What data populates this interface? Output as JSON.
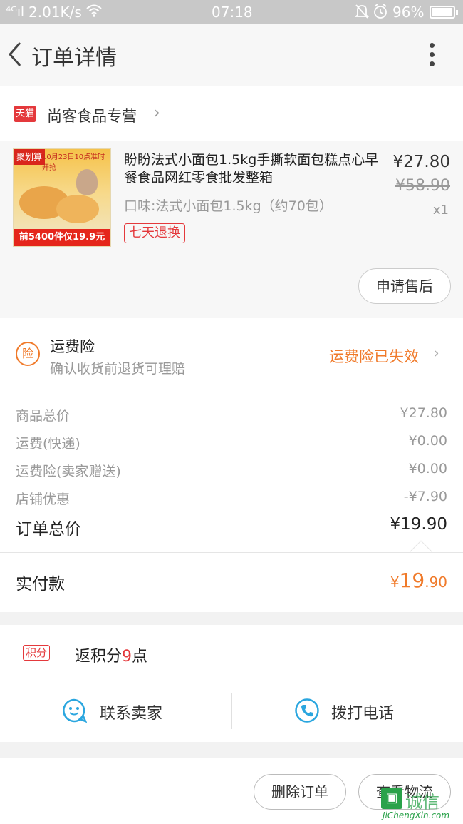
{
  "status_bar": {
    "signal": "⁴ᴳıl",
    "speed": "2.01K/s",
    "time": "07:18",
    "battery": "96%",
    "battery_level": 0.96
  },
  "header": {
    "title": "订单详情"
  },
  "shop": {
    "badge": "天猫",
    "name": "尚客食品专营"
  },
  "product": {
    "thumb_top_tag": "聚划算",
    "thumb_date_tag": "10月23日10点准时开抢",
    "thumb_promo": "前5400件仅19.9元",
    "title": "盼盼法式小面包1.5kg手撕软面包糕点心早餐食品网红零食批发整箱",
    "spec": "口味:法式小面包1.5kg（约70包）",
    "return_badge": "七天退换",
    "price": "¥27.80",
    "original_price": "¥58.90",
    "quantity": "x1",
    "after_sale_button": "申请售后"
  },
  "insurance": {
    "icon_char": "险",
    "title": "运费险",
    "subtitle": "确认收货前退货可理赔",
    "status": "运费险已失效"
  },
  "costs": {
    "rows": [
      {
        "label": "商品总价",
        "value": "¥27.80"
      },
      {
        "label": "运费(快递)",
        "value": "¥0.00"
      },
      {
        "label": "运费险(卖家赠送)",
        "value": "¥0.00"
      },
      {
        "label": "店铺优惠",
        "value": "-¥7.90"
      }
    ],
    "total_label": "订单总价",
    "total_value": "¥19.90"
  },
  "paid": {
    "label": "实付款",
    "currency": "¥",
    "integer": "19",
    "decimal": ".90"
  },
  "points": {
    "tag": "积分",
    "prefix": "返积分",
    "count": "9",
    "suffix": "点"
  },
  "contact": {
    "seller_label": "联系卖家",
    "phone_label": "拨打电话"
  },
  "footer": {
    "delete_button": "删除订单",
    "logistics_button": "查看物流"
  },
  "watermark": {
    "cn": "诚信",
    "en": "JiChengXin.com"
  },
  "colors": {
    "accent_orange": "#f07a2a",
    "tmall_red": "#e4393c",
    "contact_blue": "#2aa6df"
  }
}
